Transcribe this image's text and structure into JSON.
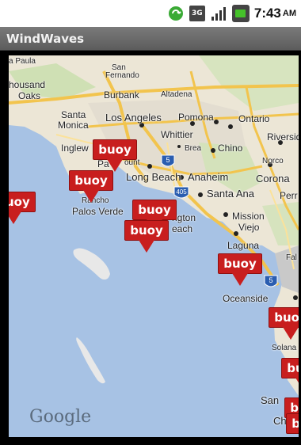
{
  "status_bar": {
    "time": "7:43",
    "ampm": "AM",
    "icons": [
      "sync-icon",
      "3g-icon",
      "signal-icon",
      "battery-icon"
    ],
    "network_label": "3G"
  },
  "app": {
    "title": "WindWaves"
  },
  "map": {
    "attribution": "Google",
    "places": [
      {
        "label": "a Paula"
      },
      {
        "label": "San"
      },
      {
        "label": "Fernando"
      },
      {
        "label": "housand"
      },
      {
        "label": "Oaks"
      },
      {
        "label": "Burbank"
      },
      {
        "label": "Altadena"
      },
      {
        "label": "Santa"
      },
      {
        "label": "Monica"
      },
      {
        "label": "Los Angeles"
      },
      {
        "label": "Pomona"
      },
      {
        "label": "Ontario"
      },
      {
        "label": "Whittier"
      },
      {
        "label": "Riversid"
      },
      {
        "label": "Inglew"
      },
      {
        "label": "Brea"
      },
      {
        "label": "Chino"
      },
      {
        "label": "Pa"
      },
      {
        "label": "ount"
      },
      {
        "label": "Norco"
      },
      {
        "label": "Long Beach"
      },
      {
        "label": "Anaheim"
      },
      {
        "label": "Corona"
      },
      {
        "label": "Santa Ana"
      },
      {
        "label": "Perr"
      },
      {
        "label": "Rancho"
      },
      {
        "label": "Palos Verde"
      },
      {
        "label": "ngton"
      },
      {
        "label": "each"
      },
      {
        "label": "Mission"
      },
      {
        "label": "Viejo"
      },
      {
        "label": "Laguna"
      },
      {
        "label": "Fal"
      },
      {
        "label": "Oceanside"
      },
      {
        "label": "Solana"
      },
      {
        "label": "San"
      },
      {
        "label": "Chula"
      }
    ],
    "markers": [
      {
        "label": "buoy"
      },
      {
        "label": "buoy"
      },
      {
        "label": "buoy"
      },
      {
        "label": "buoy"
      },
      {
        "label": "buoy"
      },
      {
        "label": "buoy"
      },
      {
        "label": "buoy"
      },
      {
        "label": "buoy"
      },
      {
        "label": "buoy"
      },
      {
        "label": "buoy"
      }
    ]
  }
}
